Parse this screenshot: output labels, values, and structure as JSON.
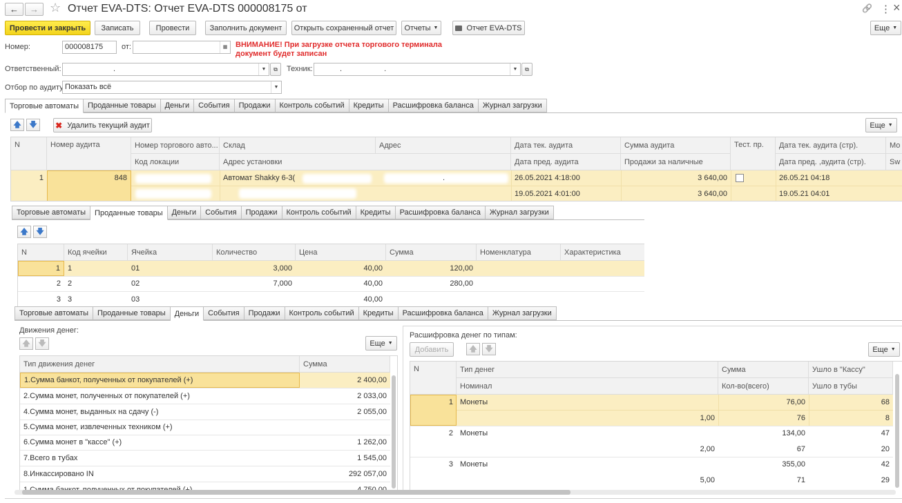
{
  "window": {
    "title": "Отчет EVA-DTS: Отчет EVA-DTS 000008175 от",
    "nav_back": "←",
    "nav_fwd": "→",
    "star": "☆",
    "link": "🔗",
    "kebab": "⋮",
    "close": "×"
  },
  "toolbar": {
    "post_close": "Провести и закрыть",
    "save": "Записать",
    "post": "Провести",
    "fill": "Заполнить документ",
    "open_saved": "Открыть сохраненный отчет",
    "reports": "Отчеты",
    "print_report": "Отчет EVA-DTS",
    "more": "Еще"
  },
  "form": {
    "number_label": "Номер:",
    "number_value": "000008175",
    "from_label": "от:",
    "from_value": "",
    "warning_line1": "ВНИМАНИЕ! При загрузке отчета торгового терминала",
    "warning_line2": "документ будет записан",
    "responsible_label": "Ответственный:",
    "responsible_value": ".",
    "tech_label": "Техник:",
    "tech_value": ".                    .",
    "filter_label": "Отбор по аудиту:",
    "filter_value": "Показать всё"
  },
  "tabs1": [
    "Торговые автоматы",
    "Проданные товары",
    "Деньги",
    "События",
    "Продажи",
    "Контроль событий",
    "Кредиты",
    "Расшифровка баланса",
    "Журнал загрузки"
  ],
  "tabs2": [
    "Торговые автоматы",
    "Проданные товары",
    "Деньги",
    "События",
    "Продажи",
    "Контроль событий",
    "Кредиты",
    "Расшифровка баланса",
    "Журнал загрузки"
  ],
  "tabs3": [
    "Торговые автоматы",
    "Проданные товары",
    "Деньги",
    "События",
    "Продажи",
    "Контроль событий",
    "Кредиты",
    "Расшифровка баланса",
    "Журнал загрузки"
  ],
  "machines_toolbar": {
    "delete_audit": "Удалить текущий аудит",
    "more": "Еще"
  },
  "machines_table": {
    "headers_top": [
      "N",
      "Номер аудита",
      "Номер торгового авто...",
      "Склад",
      "Адрес",
      "Дата тек. аудита",
      "Сумма аудита",
      "Тест. пр.",
      "Дата тек. аудита (стр).",
      "Мо"
    ],
    "headers_bottom": [
      "Код локации",
      "Адрес установки",
      "Дата пред. аудита",
      "Продажи за наличные",
      "Дата пред. ,аудита  (стр).",
      "Sw"
    ],
    "row": {
      "n": "1",
      "audit_no": "848",
      "warehouse": "Автомат Shakky 6-3(",
      "address_dot": ".",
      "cur_date": "26.05.2021 4:18:00",
      "audit_sum": "3 640,00",
      "cur_date_str": "26.05.21 04:18",
      "prev_date": "19.05.2021 4:01:00",
      "cash_sales": "3 640,00",
      "prev_date_str": "19.05.21 04:01"
    }
  },
  "goods_table": {
    "headers": [
      "N",
      "Код ячейки",
      "Ячейка",
      "Количество",
      "Цена",
      "Сумма",
      "Номенклатура",
      "Характеристика"
    ],
    "rows": [
      {
        "n": "1",
        "code": "1",
        "cell": "01",
        "qty": "3,000",
        "price": "40,00",
        "sum": "120,00"
      },
      {
        "n": "2",
        "code": "2",
        "cell": "02",
        "qty": "7,000",
        "price": "40,00",
        "sum": "280,00"
      },
      {
        "n": "3",
        "code": "3",
        "cell": "03",
        "qty": "",
        "price": "40,00",
        "sum": ""
      }
    ]
  },
  "money": {
    "movements_label": "Движения денег:",
    "more": "Еще",
    "headers": [
      "Тип движения денег",
      "Сумма"
    ],
    "rows": [
      {
        "type": "1.Сумма банкот, полученных от покупателей (+)",
        "sum": "2 400,00"
      },
      {
        "type": "2.Сумма монет, полученных от покупателей (+)",
        "sum": "2 033,00"
      },
      {
        "type": "4.Сумма монет, выданных на сдачу (-)",
        "sum": "2 055,00"
      },
      {
        "type": "5.Сумма монет, извлеченных техником (+)",
        "sum": ""
      },
      {
        "type": "6.Сумма монет в \"кассе\" (+)",
        "sum": "1 262,00"
      },
      {
        "type": "7.Всего в тубах",
        "sum": "1 545,00"
      },
      {
        "type": "8.Инкассировано IN",
        "sum": "292 057,00"
      },
      {
        "type": "1.Сумма банкот, полученных от покупателей (+)",
        "sum": "4 750,00"
      }
    ]
  },
  "money_types": {
    "label": "Расшифровка денег по типам:",
    "add": "Добавить",
    "more": "Еще",
    "headers_top": [
      "N",
      "Тип денег",
      "Сумма",
      "Ушло в \"Кассу\""
    ],
    "headers_bottom": [
      "Номинал",
      "Кол-во(всего)",
      "Ушло в тубы"
    ],
    "rows": [
      {
        "n": "1",
        "type": "Монеты",
        "sum": "76,00",
        "cash": "68",
        "nominal": "1,00",
        "count": "76",
        "tubes": "8"
      },
      {
        "n": "2",
        "type": "Монеты",
        "sum": "134,00",
        "cash": "47",
        "nominal": "2,00",
        "count": "67",
        "tubes": "20"
      },
      {
        "n": "3",
        "type": "Монеты",
        "sum": "355,00",
        "cash": "42",
        "nominal": "5,00",
        "count": "71",
        "tubes": "29"
      }
    ]
  },
  "colors": {
    "primary": "#f3d41c",
    "selection": "#fbeec2",
    "warning": "#e02b2b",
    "arrows": "#3b78c9",
    "delete_icon": "#d9251c"
  }
}
